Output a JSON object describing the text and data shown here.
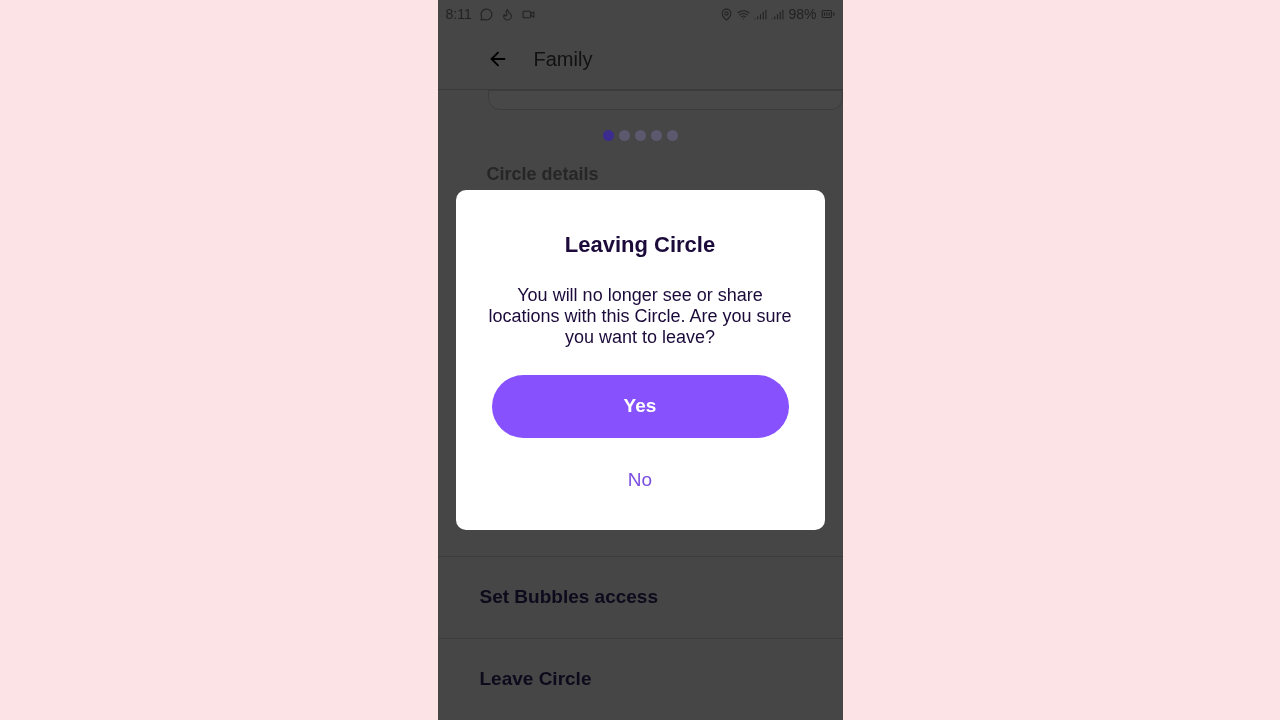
{
  "status_bar": {
    "time": "8:11",
    "battery": "98%"
  },
  "header": {
    "title": "Family"
  },
  "pager": [
    {
      "selected": true
    },
    {
      "selected": false
    },
    {
      "selected": false
    },
    {
      "selected": false
    },
    {
      "selected": false
    }
  ],
  "section_title": "Circle details",
  "rows": [
    {
      "label": "Set Bubbles access"
    },
    {
      "label": "Leave Circle"
    }
  ],
  "dialog": {
    "title": "Leaving Circle",
    "message": "You will no longer see or share locations with this Circle. Are you sure you want to leave?",
    "confirm": "Yes",
    "cancel": "No"
  }
}
